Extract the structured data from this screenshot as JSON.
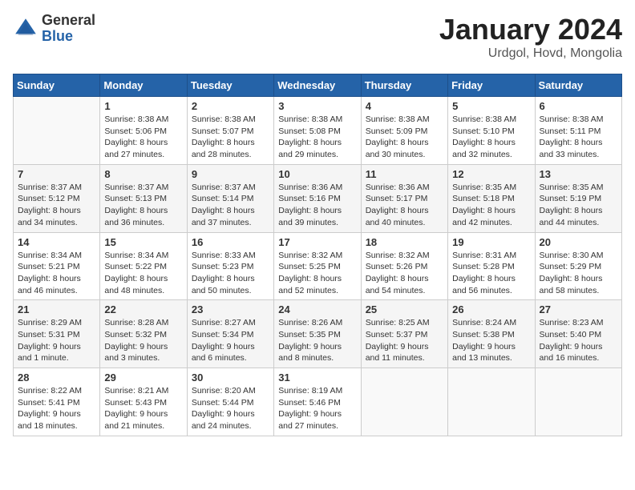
{
  "header": {
    "logo_general": "General",
    "logo_blue": "Blue",
    "month_title": "January 2024",
    "location": "Urdgol, Hovd, Mongolia"
  },
  "calendar": {
    "days_of_week": [
      "Sunday",
      "Monday",
      "Tuesday",
      "Wednesday",
      "Thursday",
      "Friday",
      "Saturday"
    ],
    "weeks": [
      [
        {
          "day": "",
          "info": ""
        },
        {
          "day": "1",
          "info": "Sunrise: 8:38 AM\nSunset: 5:06 PM\nDaylight: 8 hours\nand 27 minutes."
        },
        {
          "day": "2",
          "info": "Sunrise: 8:38 AM\nSunset: 5:07 PM\nDaylight: 8 hours\nand 28 minutes."
        },
        {
          "day": "3",
          "info": "Sunrise: 8:38 AM\nSunset: 5:08 PM\nDaylight: 8 hours\nand 29 minutes."
        },
        {
          "day": "4",
          "info": "Sunrise: 8:38 AM\nSunset: 5:09 PM\nDaylight: 8 hours\nand 30 minutes."
        },
        {
          "day": "5",
          "info": "Sunrise: 8:38 AM\nSunset: 5:10 PM\nDaylight: 8 hours\nand 32 minutes."
        },
        {
          "day": "6",
          "info": "Sunrise: 8:38 AM\nSunset: 5:11 PM\nDaylight: 8 hours\nand 33 minutes."
        }
      ],
      [
        {
          "day": "7",
          "info": "Sunrise: 8:37 AM\nSunset: 5:12 PM\nDaylight: 8 hours\nand 34 minutes."
        },
        {
          "day": "8",
          "info": "Sunrise: 8:37 AM\nSunset: 5:13 PM\nDaylight: 8 hours\nand 36 minutes."
        },
        {
          "day": "9",
          "info": "Sunrise: 8:37 AM\nSunset: 5:14 PM\nDaylight: 8 hours\nand 37 minutes."
        },
        {
          "day": "10",
          "info": "Sunrise: 8:36 AM\nSunset: 5:16 PM\nDaylight: 8 hours\nand 39 minutes."
        },
        {
          "day": "11",
          "info": "Sunrise: 8:36 AM\nSunset: 5:17 PM\nDaylight: 8 hours\nand 40 minutes."
        },
        {
          "day": "12",
          "info": "Sunrise: 8:35 AM\nSunset: 5:18 PM\nDaylight: 8 hours\nand 42 minutes."
        },
        {
          "day": "13",
          "info": "Sunrise: 8:35 AM\nSunset: 5:19 PM\nDaylight: 8 hours\nand 44 minutes."
        }
      ],
      [
        {
          "day": "14",
          "info": "Sunrise: 8:34 AM\nSunset: 5:21 PM\nDaylight: 8 hours\nand 46 minutes."
        },
        {
          "day": "15",
          "info": "Sunrise: 8:34 AM\nSunset: 5:22 PM\nDaylight: 8 hours\nand 48 minutes."
        },
        {
          "day": "16",
          "info": "Sunrise: 8:33 AM\nSunset: 5:23 PM\nDaylight: 8 hours\nand 50 minutes."
        },
        {
          "day": "17",
          "info": "Sunrise: 8:32 AM\nSunset: 5:25 PM\nDaylight: 8 hours\nand 52 minutes."
        },
        {
          "day": "18",
          "info": "Sunrise: 8:32 AM\nSunset: 5:26 PM\nDaylight: 8 hours\nand 54 minutes."
        },
        {
          "day": "19",
          "info": "Sunrise: 8:31 AM\nSunset: 5:28 PM\nDaylight: 8 hours\nand 56 minutes."
        },
        {
          "day": "20",
          "info": "Sunrise: 8:30 AM\nSunset: 5:29 PM\nDaylight: 8 hours\nand 58 minutes."
        }
      ],
      [
        {
          "day": "21",
          "info": "Sunrise: 8:29 AM\nSunset: 5:31 PM\nDaylight: 9 hours\nand 1 minute."
        },
        {
          "day": "22",
          "info": "Sunrise: 8:28 AM\nSunset: 5:32 PM\nDaylight: 9 hours\nand 3 minutes."
        },
        {
          "day": "23",
          "info": "Sunrise: 8:27 AM\nSunset: 5:34 PM\nDaylight: 9 hours\nand 6 minutes."
        },
        {
          "day": "24",
          "info": "Sunrise: 8:26 AM\nSunset: 5:35 PM\nDaylight: 9 hours\nand 8 minutes."
        },
        {
          "day": "25",
          "info": "Sunrise: 8:25 AM\nSunset: 5:37 PM\nDaylight: 9 hours\nand 11 minutes."
        },
        {
          "day": "26",
          "info": "Sunrise: 8:24 AM\nSunset: 5:38 PM\nDaylight: 9 hours\nand 13 minutes."
        },
        {
          "day": "27",
          "info": "Sunrise: 8:23 AM\nSunset: 5:40 PM\nDaylight: 9 hours\nand 16 minutes."
        }
      ],
      [
        {
          "day": "28",
          "info": "Sunrise: 8:22 AM\nSunset: 5:41 PM\nDaylight: 9 hours\nand 18 minutes."
        },
        {
          "day": "29",
          "info": "Sunrise: 8:21 AM\nSunset: 5:43 PM\nDaylight: 9 hours\nand 21 minutes."
        },
        {
          "day": "30",
          "info": "Sunrise: 8:20 AM\nSunset: 5:44 PM\nDaylight: 9 hours\nand 24 minutes."
        },
        {
          "day": "31",
          "info": "Sunrise: 8:19 AM\nSunset: 5:46 PM\nDaylight: 9 hours\nand 27 minutes."
        },
        {
          "day": "",
          "info": ""
        },
        {
          "day": "",
          "info": ""
        },
        {
          "day": "",
          "info": ""
        }
      ]
    ]
  }
}
